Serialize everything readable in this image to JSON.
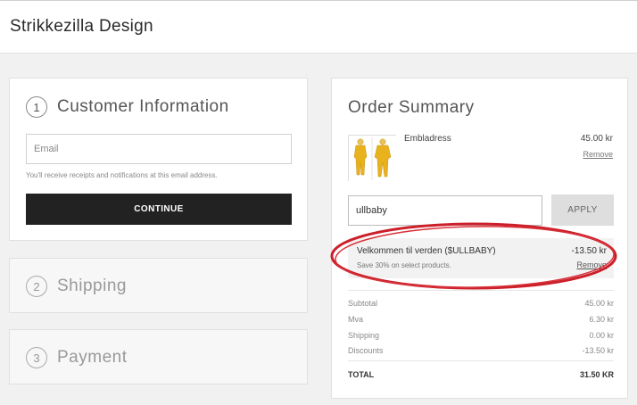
{
  "brand": "Strikkezilla Design",
  "customer": {
    "step": "1",
    "title": "Customer Information",
    "email_placeholder": "Email",
    "email_hint": "You'll receive receipts and notifications at this email address.",
    "continue_label": "CONTINUE"
  },
  "shipping": {
    "step": "2",
    "title": "Shipping"
  },
  "payment": {
    "step": "3",
    "title": "Payment"
  },
  "summary": {
    "title": "Order Summary",
    "item": {
      "name": "Embladress",
      "price": "45.00 kr",
      "remove_label": "Remove"
    },
    "coupon_value": "ullbaby",
    "apply_label": "APPLY",
    "discount": {
      "name": "Velkommen til verden ($ULLBABY)",
      "amount": "-13.50 kr",
      "description": "Save 30% on select products.",
      "remove_label": "Remove"
    },
    "totals": [
      {
        "label": "Subtotal",
        "value": "45.00 kr"
      },
      {
        "label": "Mva",
        "value": "6.30 kr"
      },
      {
        "label": "Shipping",
        "value": "0.00 kr"
      },
      {
        "label": "Discounts",
        "value": "-13.50 kr"
      }
    ],
    "total_label": "TOTAL",
    "total_value": "31.50 KR"
  },
  "colors": {
    "continue_bg": "#222222",
    "annotation_ring": "#cc1f2a",
    "product_yellow": "#e8b21e"
  }
}
